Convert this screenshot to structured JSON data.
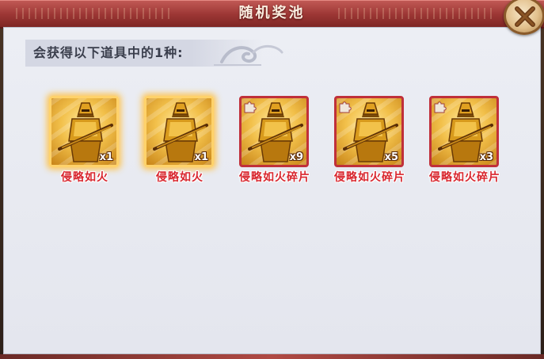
{
  "dialog": {
    "title": "随机奖池",
    "close_icon": "close-x-icon"
  },
  "header": {
    "text": "会获得以下道具中的1种:"
  },
  "items": [
    {
      "name": "侵略如火",
      "quantity": "x1",
      "kind": "item",
      "frame": "glow",
      "icon": "golden-knight-icon"
    },
    {
      "name": "侵略如火",
      "quantity": "x1",
      "kind": "item",
      "frame": "glow",
      "icon": "golden-knight-icon"
    },
    {
      "name": "侵略如火碎片",
      "quantity": "x9",
      "kind": "fragment",
      "frame": "red",
      "icon": "golden-knight-icon"
    },
    {
      "name": "侵略如火碎片",
      "quantity": "x5",
      "kind": "fragment",
      "frame": "red",
      "icon": "golden-knight-icon"
    },
    {
      "name": "侵略如火碎片",
      "quantity": "x3",
      "kind": "fragment",
      "frame": "red",
      "icon": "golden-knight-icon"
    }
  ],
  "colors": {
    "title_bar": "#9c3634",
    "item_name": "#d8262e",
    "fragment_frame": "#c0303a",
    "glow_frame": "#ffd26a"
  }
}
